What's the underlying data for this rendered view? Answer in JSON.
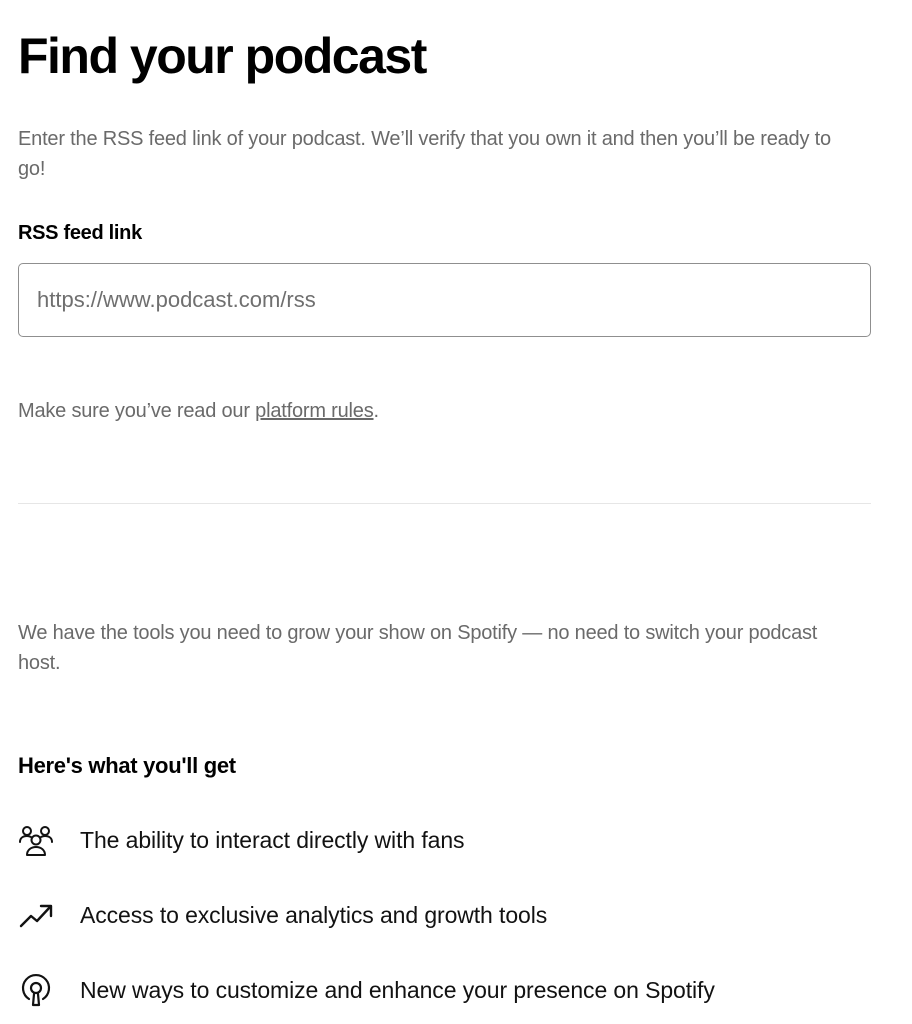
{
  "header": {
    "title": "Find your podcast"
  },
  "intro": "Enter the RSS feed link of your podcast. We’ll verify that you own it and then you’ll be ready to go!",
  "rss_field": {
    "label": "RSS feed link",
    "placeholder": "https://www.podcast.com/rss",
    "value": ""
  },
  "rules": {
    "prefix": "Make sure you’ve read our ",
    "link_label": "platform rules",
    "suffix": "."
  },
  "tools_text": "We have the tools you need to grow your show on Spotify — no need to switch your podcast host.",
  "benefits": {
    "title": "Here's what you'll get",
    "items": [
      {
        "icon": "fans-icon",
        "label": "The ability to interact directly with fans"
      },
      {
        "icon": "trending-up-icon",
        "label": "Access to exclusive analytics and growth tools"
      },
      {
        "icon": "podcast-icon",
        "label": "New ways to customize and enhance your presence on Spotify"
      }
    ]
  }
}
